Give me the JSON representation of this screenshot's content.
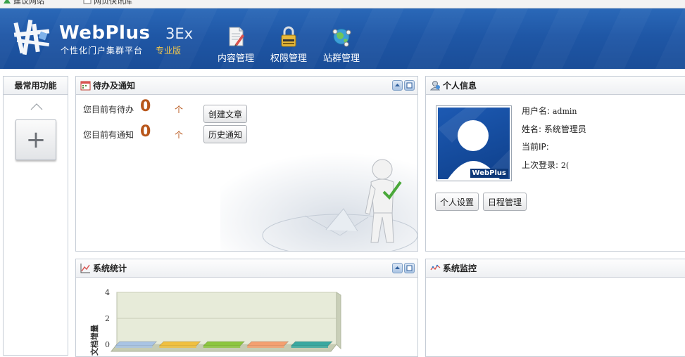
{
  "toolbar": {
    "items": [
      "建议网站",
      "网页快讯库"
    ]
  },
  "header": {
    "brand": "WebPlus",
    "version": "3Ex",
    "subtitle": "个性化门户集群平台",
    "edition": "专业版",
    "nav": [
      {
        "label": "内容管理",
        "icon": "document-pen-icon"
      },
      {
        "label": "权限管理",
        "icon": "padlock-icon"
      },
      {
        "label": "站群管理",
        "icon": "globe-network-icon"
      }
    ]
  },
  "favorites": {
    "title": "最常用功能",
    "add_label": "+"
  },
  "todo": {
    "title": "待办及通知",
    "rows": [
      {
        "label": "您目前有待办",
        "count": "0",
        "unit": "个",
        "button": "创建文章"
      },
      {
        "label": "您目前有通知",
        "count": "0",
        "unit": "个",
        "button": "历史通知"
      }
    ]
  },
  "profile": {
    "title": "个人信息",
    "avatar_brand": "WebPlus",
    "fields": [
      {
        "label": "用户名:",
        "value": "admin"
      },
      {
        "label": "姓名:",
        "value": "系统管理员"
      },
      {
        "label": "当前IP:",
        "value": ""
      },
      {
        "label": "上次登录:",
        "value": "2("
      }
    ],
    "buttons": [
      "个人设置",
      "日程管理"
    ]
  },
  "stats": {
    "title": "系统统计"
  },
  "monitor": {
    "title": "系统监控"
  },
  "colors": {
    "header_bg": "#1f57a6",
    "count_accent": "#b8561a",
    "edition_accent": "#f6c94a"
  },
  "chart_data": {
    "type": "bar",
    "ylabel": "文档增量",
    "ylim": [
      0,
      4
    ],
    "yticks": [
      0,
      2,
      4
    ],
    "categories": [
      "",
      "",
      "",
      "",
      ""
    ],
    "values": [
      0,
      0,
      0,
      0,
      0
    ],
    "bar_colors": [
      "#a9c4e4",
      "#f0c040",
      "#8cc63f",
      "#f4a070",
      "#3aa8a0"
    ]
  }
}
